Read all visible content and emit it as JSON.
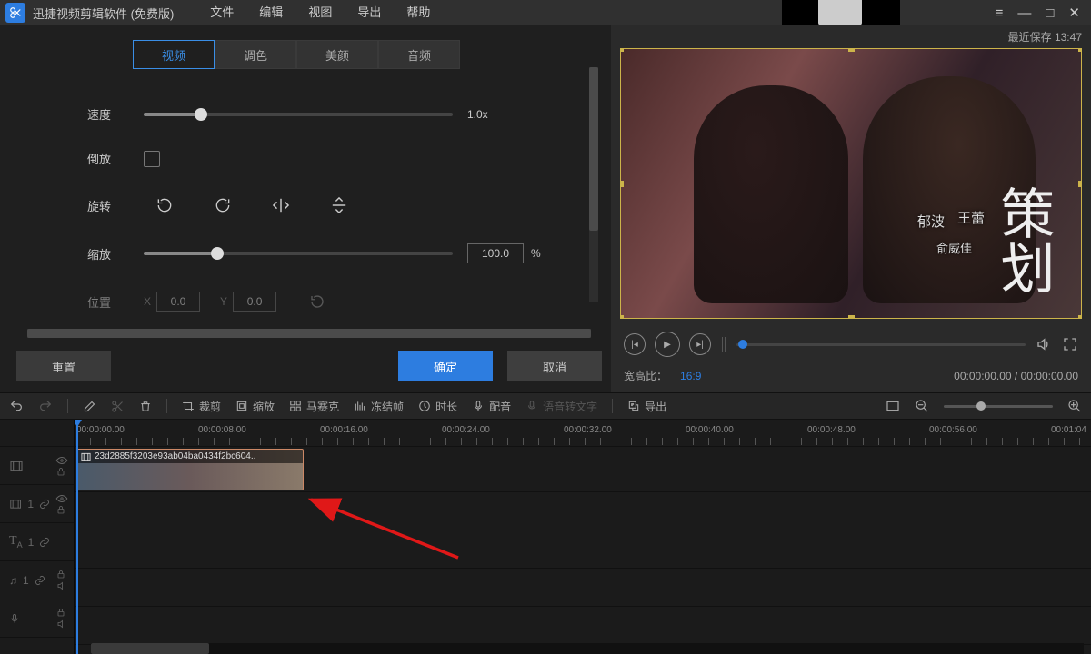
{
  "app": {
    "title": "迅捷视频剪辑软件 (免费版)"
  },
  "menu": {
    "file": "文件",
    "edit": "编辑",
    "view": "视图",
    "export": "导出",
    "help": "帮助"
  },
  "tabs": {
    "video": "视频",
    "color": "调色",
    "beauty": "美颜",
    "audio": "音频"
  },
  "panel": {
    "speed": "速度",
    "speed_val": "1.0x",
    "reverse": "倒放",
    "rotate": "旋转",
    "scale": "缩放",
    "scale_val": "100.0",
    "scale_unit": "%",
    "position": "位置",
    "pos_x_lbl": "X",
    "pos_x": "0.0",
    "pos_y_lbl": "Y",
    "pos_y": "0.0"
  },
  "buttons": {
    "reset": "重置",
    "ok": "确定",
    "cancel": "取消"
  },
  "preview": {
    "last_save": "最近保存 13:47",
    "credit1": "郁波",
    "credit2": "王蕾",
    "credit3": "俞威佳",
    "big": "策划",
    "aspect_lbl": "宽高比：",
    "aspect_val": "16:9",
    "tc_now": "00:00:00.00",
    "tc_sep": " / ",
    "tc_dur": "00:00:00.00"
  },
  "toolbar": {
    "crop": "裁剪",
    "scale": "缩放",
    "mosaic": "马赛克",
    "freeze": "冻结帧",
    "duration": "时长",
    "dub": "配音",
    "stt": "语音转文字",
    "export": "导出"
  },
  "timeline": {
    "ticks": [
      "00:00:00.00",
      "00:00:08.00",
      "00:00:16.00",
      "00:00:24.00",
      "00:00:32.00",
      "00:00:40.00",
      "00:00:48.00",
      "00:00:56.00",
      "00:01:04"
    ],
    "clip_name": "23d2885f3203e93ab04ba0434f2bc604..",
    "track_index": "1"
  }
}
